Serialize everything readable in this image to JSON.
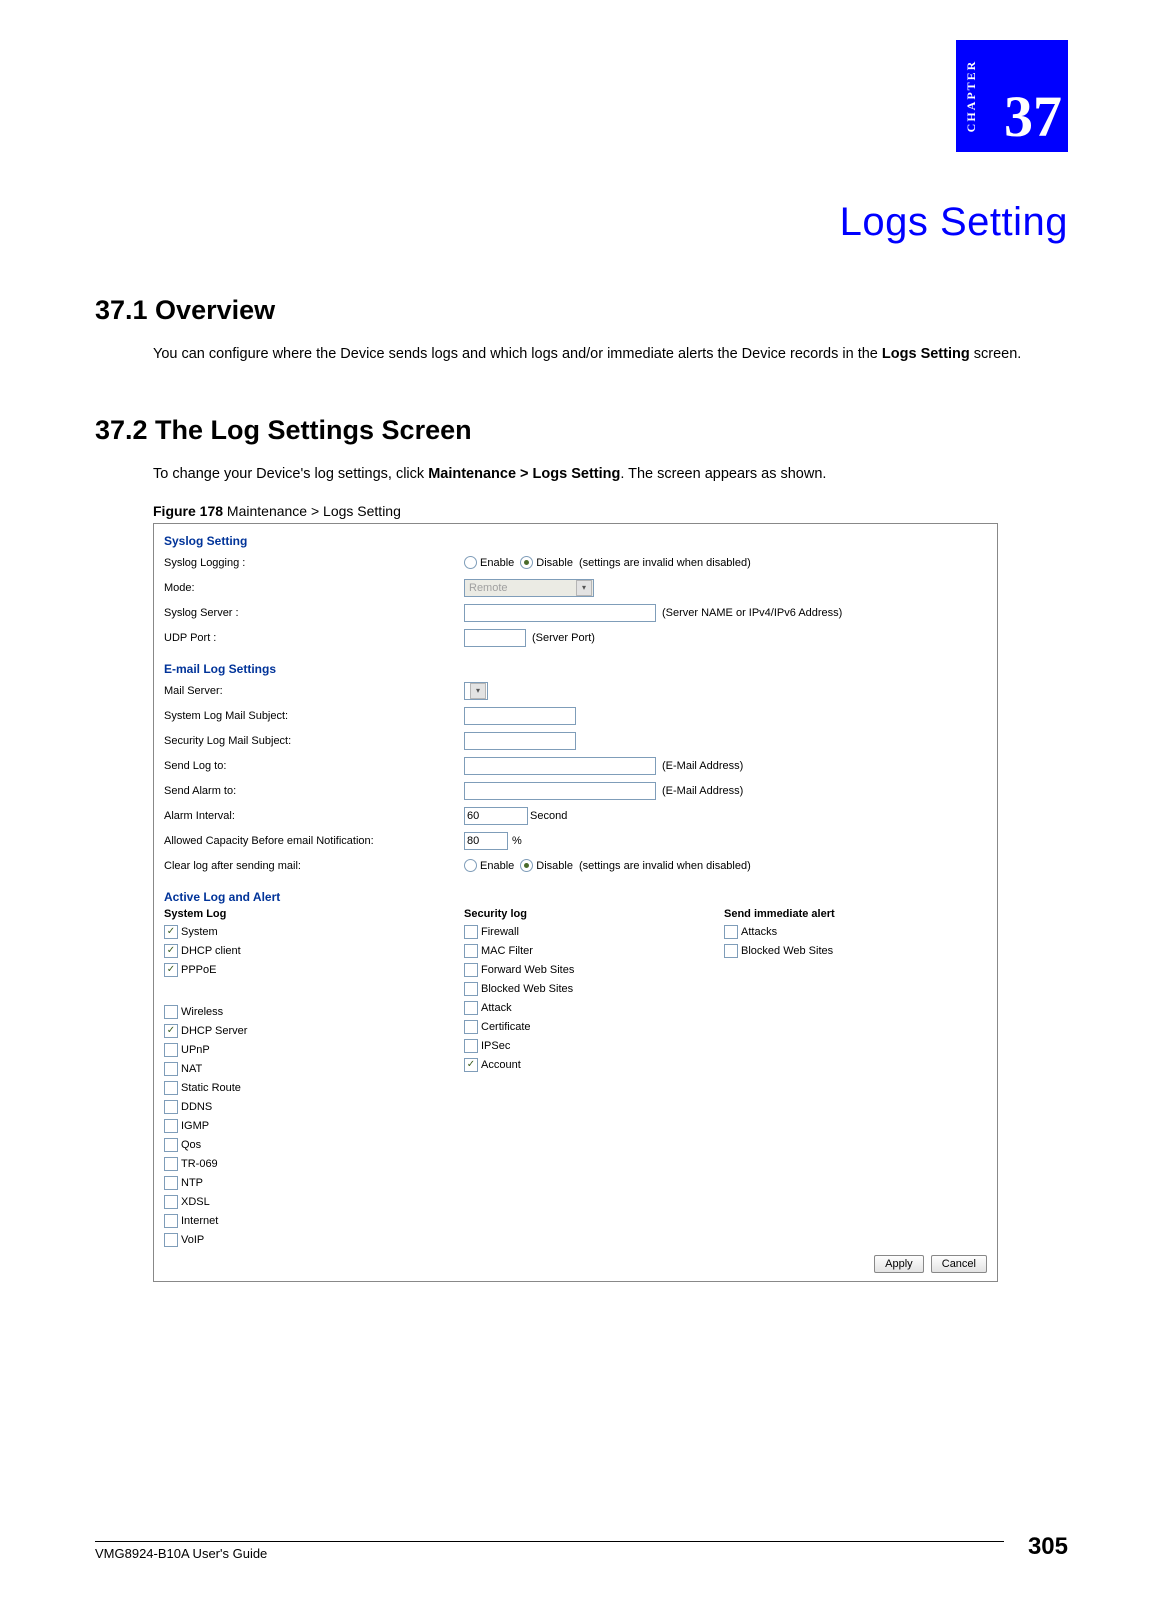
{
  "chapter": {
    "label": "CHAPTER",
    "number": "37",
    "title": "Logs Setting"
  },
  "section1": {
    "heading": "37.1  Overview",
    "p1_a": "You can configure where the Device sends logs and which logs and/or immediate alerts the Device records in the ",
    "p1_b": "Logs Setting",
    "p1_c": " screen."
  },
  "section2": {
    "heading": "37.2  The Log Settings Screen",
    "p1_a": "To change your Device's log settings, click ",
    "p1_b": "Maintenance > Logs Setting",
    "p1_c": ". The screen appears as shown.",
    "figcap_b": "Figure 178",
    "figcap_t": "   Maintenance > Logs Setting"
  },
  "screenshot": {
    "syslog": {
      "title": "Syslog Setting",
      "rows": {
        "logging": {
          "label": "Syslog Logging :",
          "opt_enable": "Enable",
          "opt_disable": "Disable",
          "note": "(settings are invalid when disabled)",
          "selected": "disable"
        },
        "mode": {
          "label": "Mode:",
          "value": "Remote"
        },
        "server": {
          "label": "Syslog Server :",
          "note": "(Server NAME or IPv4/IPv6 Address)"
        },
        "udp": {
          "label": "UDP Port :",
          "note": "(Server Port)"
        }
      }
    },
    "email": {
      "title": "E-mail Log Settings",
      "rows": {
        "mailserver": {
          "label": "Mail Server:"
        },
        "sys_subj": {
          "label": "System Log Mail Subject:"
        },
        "sec_subj": {
          "label": "Security Log Mail Subject:"
        },
        "sendlog": {
          "label": "Send Log to:",
          "note": "(E-Mail Address)"
        },
        "sendalarm": {
          "label": "Send Alarm to:",
          "note": "(E-Mail Address)"
        },
        "alarmint": {
          "label": "Alarm Interval:",
          "value": "60",
          "unit": "Second"
        },
        "capacity": {
          "label": "Allowed Capacity Before email Notification:",
          "value": "80",
          "unit": "%"
        },
        "clear": {
          "label": "Clear log after sending mail:",
          "opt_enable": "Enable",
          "opt_disable": "Disable",
          "note": "(settings are invalid when disabled)",
          "selected": "disable"
        }
      }
    },
    "active": {
      "title": "Active Log and Alert",
      "cols": {
        "system": {
          "head": "System Log",
          "items": [
            {
              "label": "System",
              "checked": true
            },
            {
              "label": "DHCP client",
              "checked": true
            },
            {
              "label": "PPPoE",
              "checked": true
            },
            {
              "label": "",
              "checked": null
            },
            {
              "label": "Wireless",
              "checked": false
            },
            {
              "label": "DHCP Server",
              "checked": true
            },
            {
              "label": "UPnP",
              "checked": false
            },
            {
              "label": "NAT",
              "checked": false
            },
            {
              "label": "Static Route",
              "checked": false
            },
            {
              "label": "DDNS",
              "checked": false
            },
            {
              "label": "IGMP",
              "checked": false
            },
            {
              "label": "Qos",
              "checked": false
            },
            {
              "label": "TR-069",
              "checked": false
            },
            {
              "label": "NTP",
              "checked": false
            },
            {
              "label": "XDSL",
              "checked": false
            },
            {
              "label": "Internet",
              "checked": false
            },
            {
              "label": "VoIP",
              "checked": false
            }
          ]
        },
        "security": {
          "head": "Security log",
          "items": [
            {
              "label": "Firewall",
              "checked": false
            },
            {
              "label": "MAC Filter",
              "checked": false
            },
            {
              "label": "Forward Web Sites",
              "checked": false
            },
            {
              "label": "Blocked Web Sites",
              "checked": false
            },
            {
              "label": "Attack",
              "checked": false
            },
            {
              "label": "Certificate",
              "checked": false
            },
            {
              "label": "IPSec",
              "checked": false
            },
            {
              "label": "Account",
              "checked": true
            }
          ]
        },
        "alert": {
          "head": "Send immediate alert",
          "items": [
            {
              "label": "Attacks",
              "checked": false
            },
            {
              "label": "Blocked Web Sites",
              "checked": false
            }
          ]
        }
      }
    },
    "buttons": {
      "apply": "Apply",
      "cancel": "Cancel"
    }
  },
  "footer": {
    "left": "VMG8924-B10A User's Guide",
    "right": "305"
  }
}
